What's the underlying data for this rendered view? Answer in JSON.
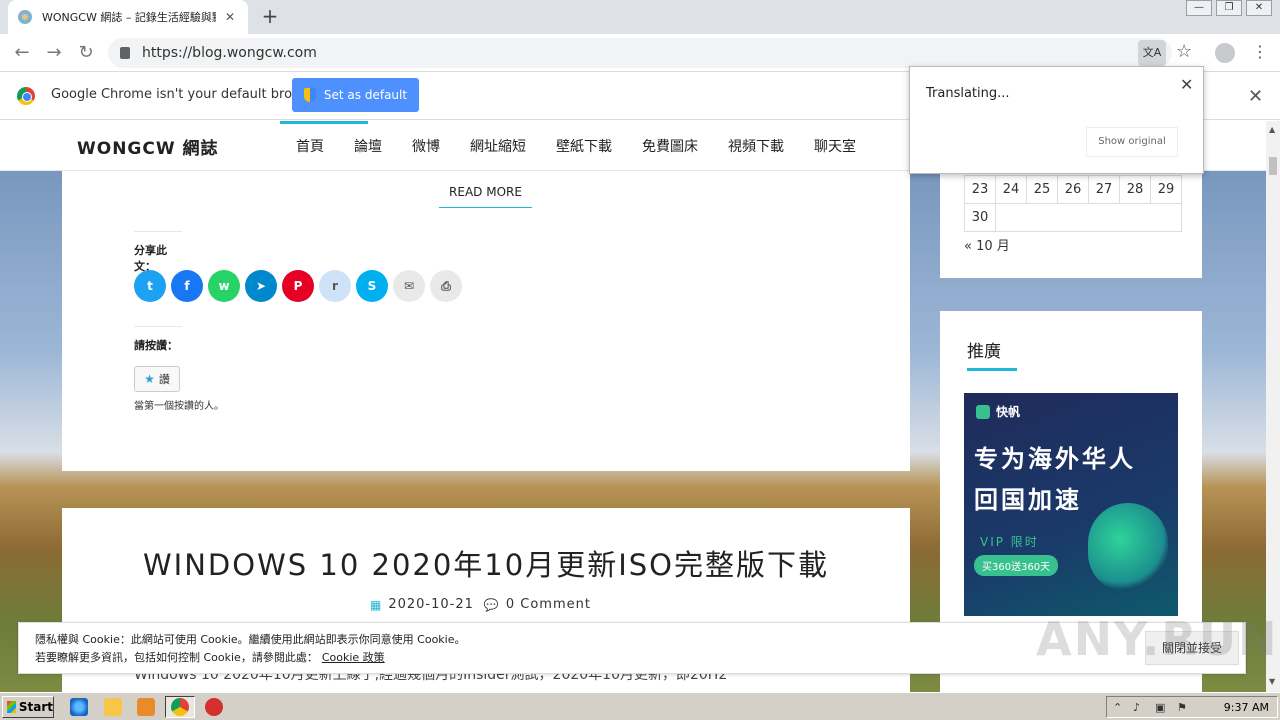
{
  "browser": {
    "tab_title": "WONGCW 網誌 – 記錄生活經驗與點",
    "tab_close": "✕",
    "new_tab": "+",
    "url": "https://blog.wongcw.com",
    "win_min": "—",
    "win_max": "❐",
    "win_close": "✕"
  },
  "infobar": {
    "message": "Google Chrome isn't your default browser",
    "set_default": "Set as default",
    "close": "✕"
  },
  "translate_popup": {
    "status": "Translating...",
    "show_original": "Show original",
    "close": "✕"
  },
  "site": {
    "title": "WONGCW 網誌",
    "nav": [
      "首頁",
      "論壇",
      "微博",
      "網址縮短",
      "壁紙下載",
      "免費圖床",
      "視頻下載",
      "聊天室"
    ]
  },
  "article1": {
    "read_more": "READ MORE",
    "share_label": "分享此文：",
    "share_buttons": [
      {
        "name": "twitter",
        "glyph": "t",
        "color": "#1da1f2"
      },
      {
        "name": "facebook",
        "glyph": "f",
        "color": "#1877f2"
      },
      {
        "name": "whatsapp",
        "glyph": "w",
        "color": "#25d366"
      },
      {
        "name": "telegram",
        "glyph": "➤",
        "color": "#0088cc"
      },
      {
        "name": "pinterest",
        "glyph": "P",
        "color": "#e60023"
      },
      {
        "name": "reddit",
        "glyph": "r",
        "color": "#cee3f8"
      },
      {
        "name": "skype",
        "glyph": "S",
        "color": "#00aff0"
      },
      {
        "name": "email",
        "glyph": "✉",
        "color": "#e9e9e9"
      },
      {
        "name": "print",
        "glyph": "⎙",
        "color": "#e9e9e9"
      }
    ],
    "like_label": "請按讚：",
    "like_button": "讚",
    "like_first": "當第一個按讚的人。"
  },
  "article2": {
    "title": "WINDOWS 10 2020年10月更新ISO完整版下載",
    "date": "2020-10-21",
    "comments": "0 Comment",
    "excerpt": "Windows 10 2020年10月更新上線了,經過幾個月的Insider測試，2020年10月更新，即20H2"
  },
  "sidebar": {
    "calendar_rows": [
      [
        "23",
        "24",
        "25",
        "26",
        "27",
        "28",
        "29"
      ],
      [
        "30"
      ]
    ],
    "prev_month": "« 10 月",
    "ad_title": "推廣",
    "ad": {
      "brand": "快帆",
      "headline1": "专为海外华人",
      "headline2": "回国加速",
      "vip": "VIP 限时",
      "offer": "买360送360天"
    }
  },
  "cookie": {
    "line1": "隱私權與 Cookie：此網站可使用 Cookie。繼續使用此網站即表示你同意使用 Cookie。",
    "line2": "若要瞭解更多資訊，包括如何控制 Cookie，請參閱此處：",
    "policy_link": "Cookie 政策",
    "accept": "關閉並接受"
  },
  "watermark": "ANY.RUN",
  "taskbar": {
    "start": "Start",
    "clock": "9:37 AM"
  }
}
